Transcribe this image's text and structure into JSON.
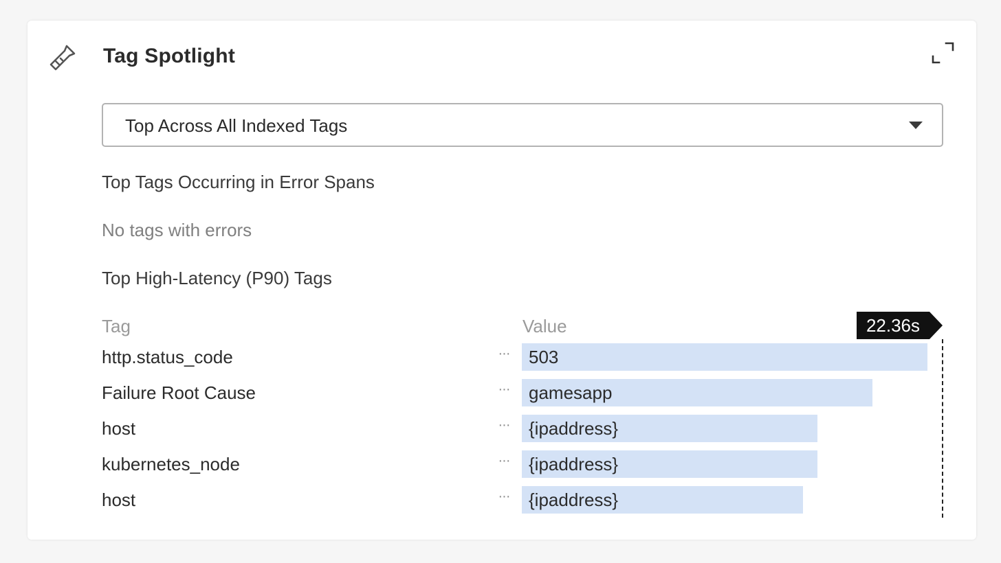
{
  "panel": {
    "title": "Tag Spotlight",
    "icon": "flashlight-icon",
    "expand_icon": "expand-icon"
  },
  "select": {
    "value": "Top Across All Indexed Tags"
  },
  "errors_section": {
    "title": "Top Tags Occurring in Error Spans",
    "empty_text": "No tags with errors"
  },
  "latency_section": {
    "title": "Top High-Latency (P90) Tags",
    "col_tag": "Tag",
    "col_value": "Value",
    "max_label": "22.36s",
    "bar_color": "#d4e2f6",
    "rows": [
      {
        "tag": "http.status_code",
        "value": "503",
        "level": 1.0
      },
      {
        "tag": "Failure Root Cause",
        "value": "gamesapp",
        "level": 0.864
      },
      {
        "tag": "host",
        "value": "{ipaddress}",
        "level": 0.728
      },
      {
        "tag": "kubernetes_node",
        "value": "{ipaddress}",
        "level": 0.728
      },
      {
        "tag": "host",
        "value": "{ipaddress}",
        "level": 0.694
      }
    ]
  }
}
